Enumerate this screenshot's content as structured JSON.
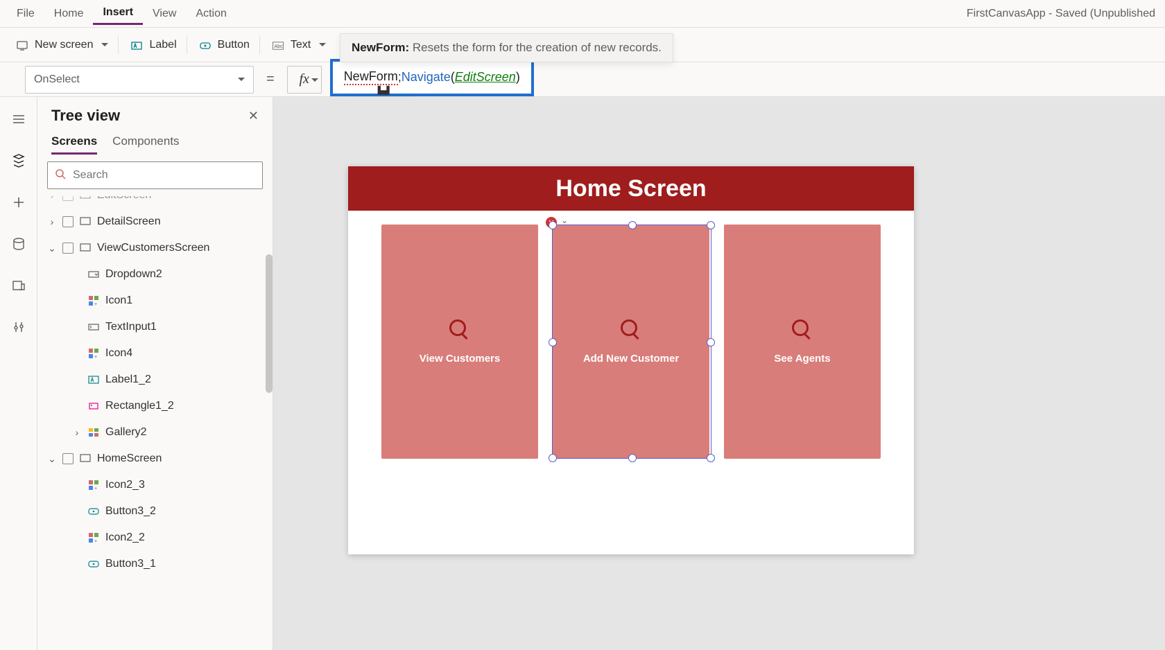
{
  "app_status": "FirstCanvasApp - Saved (Unpublished",
  "menubar": {
    "items": [
      "File",
      "Home",
      "Insert",
      "View",
      "Action"
    ],
    "active_index": 2
  },
  "ribbon": {
    "new_screen": "New screen",
    "label": "Label",
    "button": "Button",
    "text": "Text"
  },
  "property_selector": "OnSelect",
  "formula": {
    "tooltip_name": "NewForm:",
    "tooltip_desc": "Resets the form for the creation of new records.",
    "token_newform": "NewForm",
    "token_sep": ";",
    "token_navigate": "Navigate",
    "token_open": "(",
    "token_arg": "EditScreen",
    "token_close": ")",
    "intellisense": "NewForm"
  },
  "tree": {
    "title": "Tree view",
    "tabs": [
      "Screens",
      "Components"
    ],
    "active_tab": 0,
    "search_placeholder": "Search",
    "nodes": [
      {
        "depth": 1,
        "exp": "›",
        "check": true,
        "icon": "screen",
        "label": "EditScreen",
        "cut": true
      },
      {
        "depth": 1,
        "exp": "›",
        "check": true,
        "icon": "screen",
        "label": "DetailScreen"
      },
      {
        "depth": 1,
        "exp": "⌄",
        "check": true,
        "icon": "screen",
        "label": "ViewCustomersScreen"
      },
      {
        "depth": 2,
        "exp": "",
        "check": false,
        "icon": "dropdown",
        "label": "Dropdown2"
      },
      {
        "depth": 2,
        "exp": "",
        "check": false,
        "icon": "iconctl",
        "label": "Icon1"
      },
      {
        "depth": 2,
        "exp": "",
        "check": false,
        "icon": "textinput",
        "label": "TextInput1"
      },
      {
        "depth": 2,
        "exp": "",
        "check": false,
        "icon": "iconctl",
        "label": "Icon4"
      },
      {
        "depth": 2,
        "exp": "",
        "check": false,
        "icon": "labelctl",
        "label": "Label1_2"
      },
      {
        "depth": 2,
        "exp": "",
        "check": false,
        "icon": "rect",
        "label": "Rectangle1_2"
      },
      {
        "depth": 2,
        "exp": "›",
        "check": false,
        "icon": "gallery",
        "label": "Gallery2"
      },
      {
        "depth": 1,
        "exp": "⌄",
        "check": true,
        "icon": "screen",
        "label": "HomeScreen"
      },
      {
        "depth": 2,
        "exp": "",
        "check": false,
        "icon": "iconctl",
        "label": "Icon2_3"
      },
      {
        "depth": 2,
        "exp": "",
        "check": false,
        "icon": "buttonctl",
        "label": "Button3_2"
      },
      {
        "depth": 2,
        "exp": "",
        "check": false,
        "icon": "iconctl",
        "label": "Icon2_2"
      },
      {
        "depth": 2,
        "exp": "",
        "check": false,
        "icon": "buttonctl",
        "label": "Button3_1",
        "cut": true
      }
    ]
  },
  "canvas": {
    "header": "Home Screen",
    "cards": [
      {
        "label": "View Customers"
      },
      {
        "label": "Add New Customer"
      },
      {
        "label": "See Agents"
      }
    ],
    "selected_card_index": 1
  }
}
